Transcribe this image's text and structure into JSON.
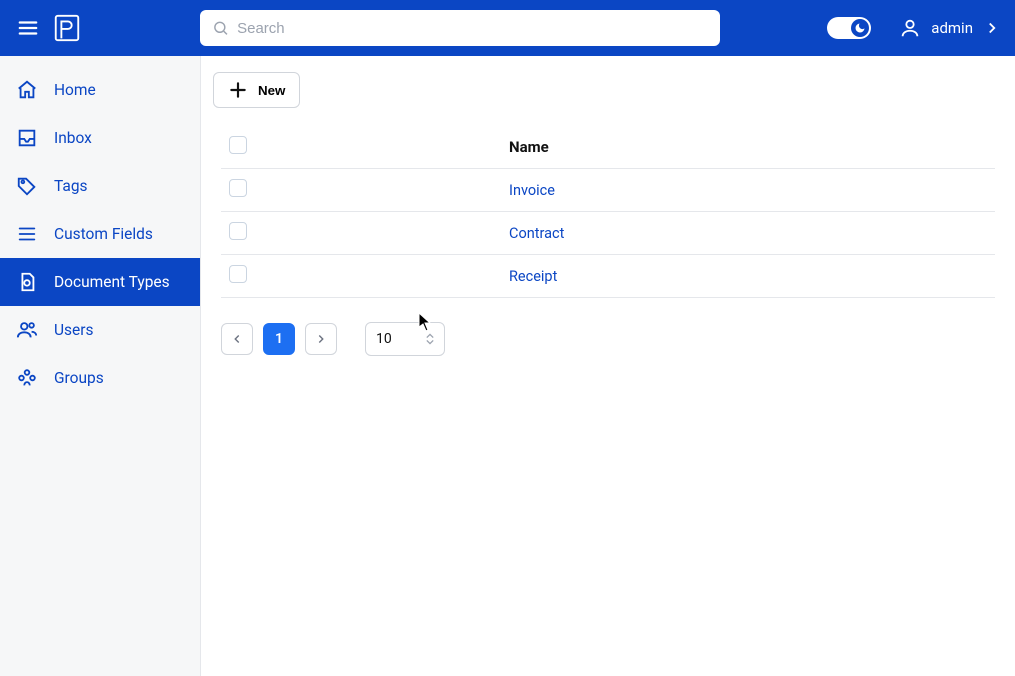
{
  "header": {
    "search_placeholder": "Search",
    "user_name": "admin"
  },
  "sidebar": {
    "items": [
      {
        "label": "Home"
      },
      {
        "label": "Inbox"
      },
      {
        "label": "Tags"
      },
      {
        "label": "Custom Fields"
      },
      {
        "label": "Document Types"
      },
      {
        "label": "Users"
      },
      {
        "label": "Groups"
      }
    ],
    "active_index": 4
  },
  "toolbar": {
    "new_label": "New"
  },
  "table": {
    "header_name": "Name",
    "rows": [
      {
        "name": "Invoice"
      },
      {
        "name": "Contract"
      },
      {
        "name": "Receipt"
      }
    ]
  },
  "pagination": {
    "current_page": "1",
    "page_size": "10"
  }
}
